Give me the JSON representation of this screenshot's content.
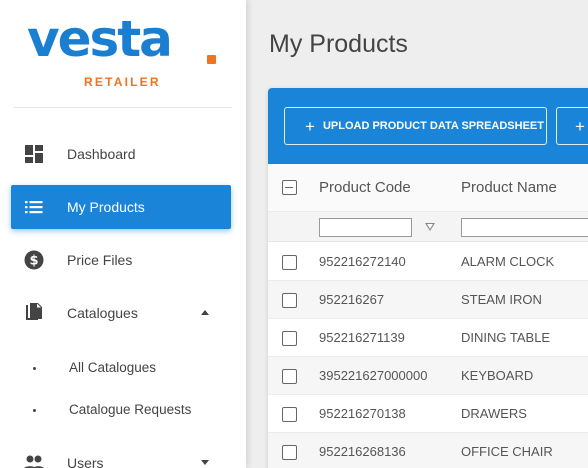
{
  "brand": {
    "name": "vesta",
    "sub": "RETAILER",
    "primary": "#1a7fd0",
    "accent": "#f0731f"
  },
  "sidebar": {
    "items": [
      {
        "label": "Dashboard",
        "icon": "dashboard-icon"
      },
      {
        "label": "My Products",
        "icon": "list-icon",
        "active": true
      },
      {
        "label": "Price Files",
        "icon": "dollar-icon"
      },
      {
        "label": "Catalogues",
        "icon": "file-copy-icon",
        "expanded": true
      },
      {
        "label": "Users",
        "icon": "people-icon",
        "expanded": false
      }
    ],
    "catalogue_sub": [
      {
        "label": "All Catalogues"
      },
      {
        "label": "Catalogue Requests"
      }
    ]
  },
  "main": {
    "title": "My Products",
    "toolbar": {
      "upload_label": "UPLOAD PRODUCT DATA SPREADSHEET",
      "second_label": "+"
    },
    "table": {
      "columns": [
        "Product Code",
        "Product Name"
      ],
      "filters": {
        "code": "",
        "name": ""
      },
      "rows": [
        {
          "code": "952216272140",
          "name": "ALARM CLOCK"
        },
        {
          "code": "952216267",
          "name": "STEAM IRON"
        },
        {
          "code": "952216271139",
          "name": "DINING TABLE"
        },
        {
          "code": "395221627000000",
          "name": "KEYBOARD"
        },
        {
          "code": "952216270138",
          "name": "DRAWERS"
        },
        {
          "code": "952216268136",
          "name": "OFFICE CHAIR"
        }
      ]
    }
  }
}
